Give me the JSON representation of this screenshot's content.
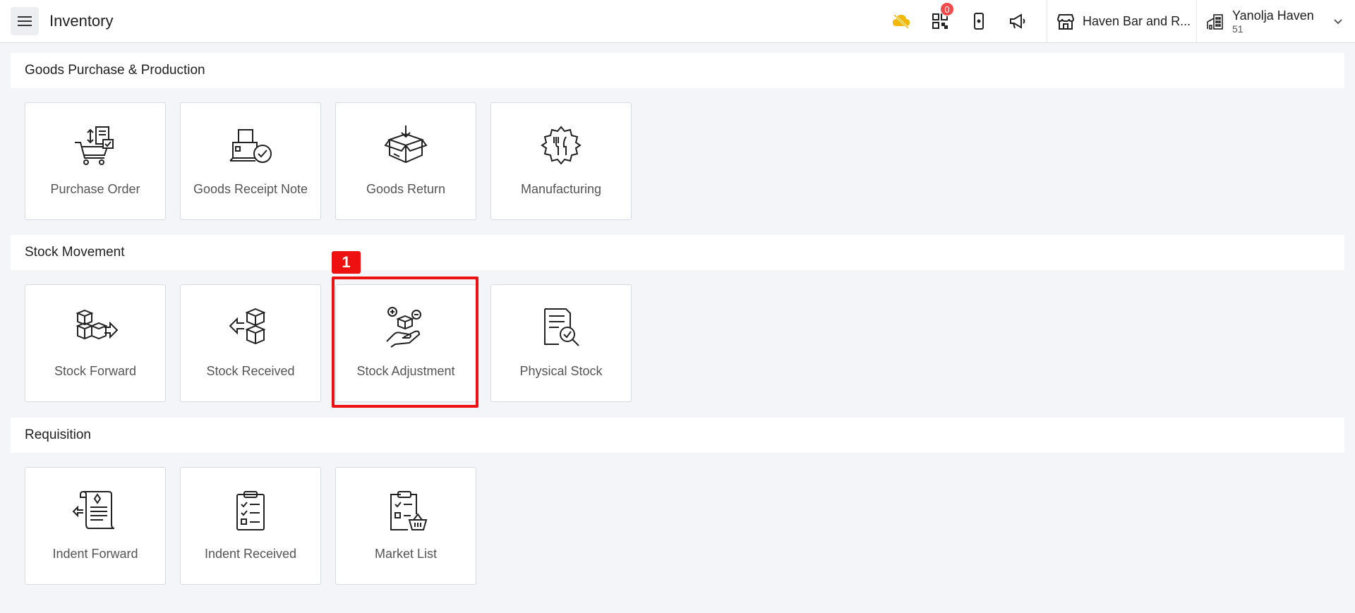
{
  "header": {
    "title": "Inventory",
    "qr_badge_count": "0",
    "store_name": "Haven Bar and R...",
    "org_name": "Yanolja Haven",
    "org_sub": "51",
    "icons": [
      "menu-icon",
      "cloud-offline-icon",
      "qr-code-icon",
      "mobile-device-icon",
      "megaphone-icon",
      "store-icon",
      "building-icon",
      "chevron-down-icon"
    ],
    "accent_color": "#f5b800"
  },
  "sections": [
    {
      "title": "Goods Purchase & Production",
      "tiles": [
        "Purchase Order",
        "Goods Receipt Note",
        "Goods Return",
        "Manufacturing"
      ]
    },
    {
      "title": "Stock Movement",
      "tiles": [
        "Stock Forward",
        "Stock Received",
        "Stock Adjustment",
        "Physical Stock"
      ]
    },
    {
      "title": "Requisition",
      "tiles": [
        "Indent Forward",
        "Indent Received",
        "Market List"
      ]
    }
  ],
  "annotation": {
    "label": "1",
    "color": "#ee1111"
  }
}
